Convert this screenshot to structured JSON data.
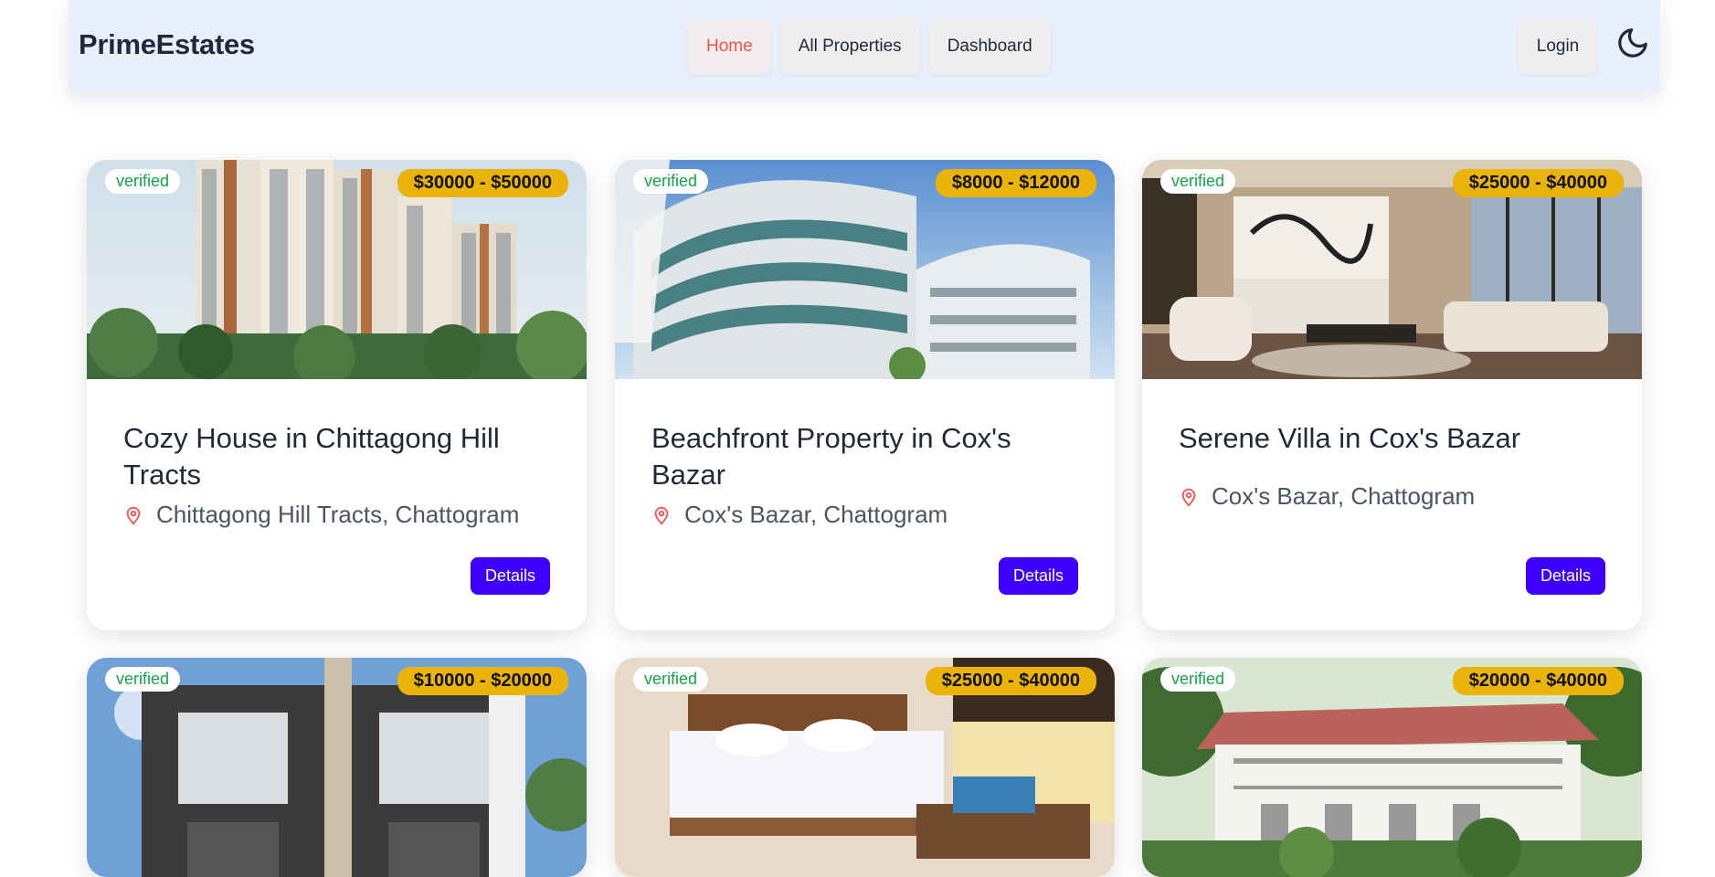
{
  "brand": "PrimeEstates",
  "nav": {
    "home": "Home",
    "all_properties": "All Properties",
    "dashboard": "Dashboard",
    "login": "Login",
    "theme_icon": "moon-icon"
  },
  "colors": {
    "accent_button": "#3d00ff",
    "price_badge": "#eab308",
    "verified_text": "#16a34a",
    "active_nav": "#ef5350"
  },
  "cards": [
    {
      "verified": "verified",
      "price": "$30000 - $50000",
      "title": "Cozy House in Chittagong Hill Tracts",
      "location": "Chittagong Hill Tracts, Chattogram",
      "details": "Details"
    },
    {
      "verified": "verified",
      "price": "$8000 - $12000",
      "title": "Beachfront Property in Cox's Bazar",
      "location": "Cox's Bazar, Chattogram",
      "details": "Details"
    },
    {
      "verified": "verified",
      "price": "$25000 - $40000",
      "title": "Serene Villa in Cox's Bazar",
      "location": "Cox's Bazar, Chattogram",
      "details": "Details"
    },
    {
      "verified": "verified",
      "price": "$10000 - $20000"
    },
    {
      "verified": "verified",
      "price": "$25000 - $40000"
    },
    {
      "verified": "verified",
      "price": "$20000 - $40000"
    }
  ]
}
